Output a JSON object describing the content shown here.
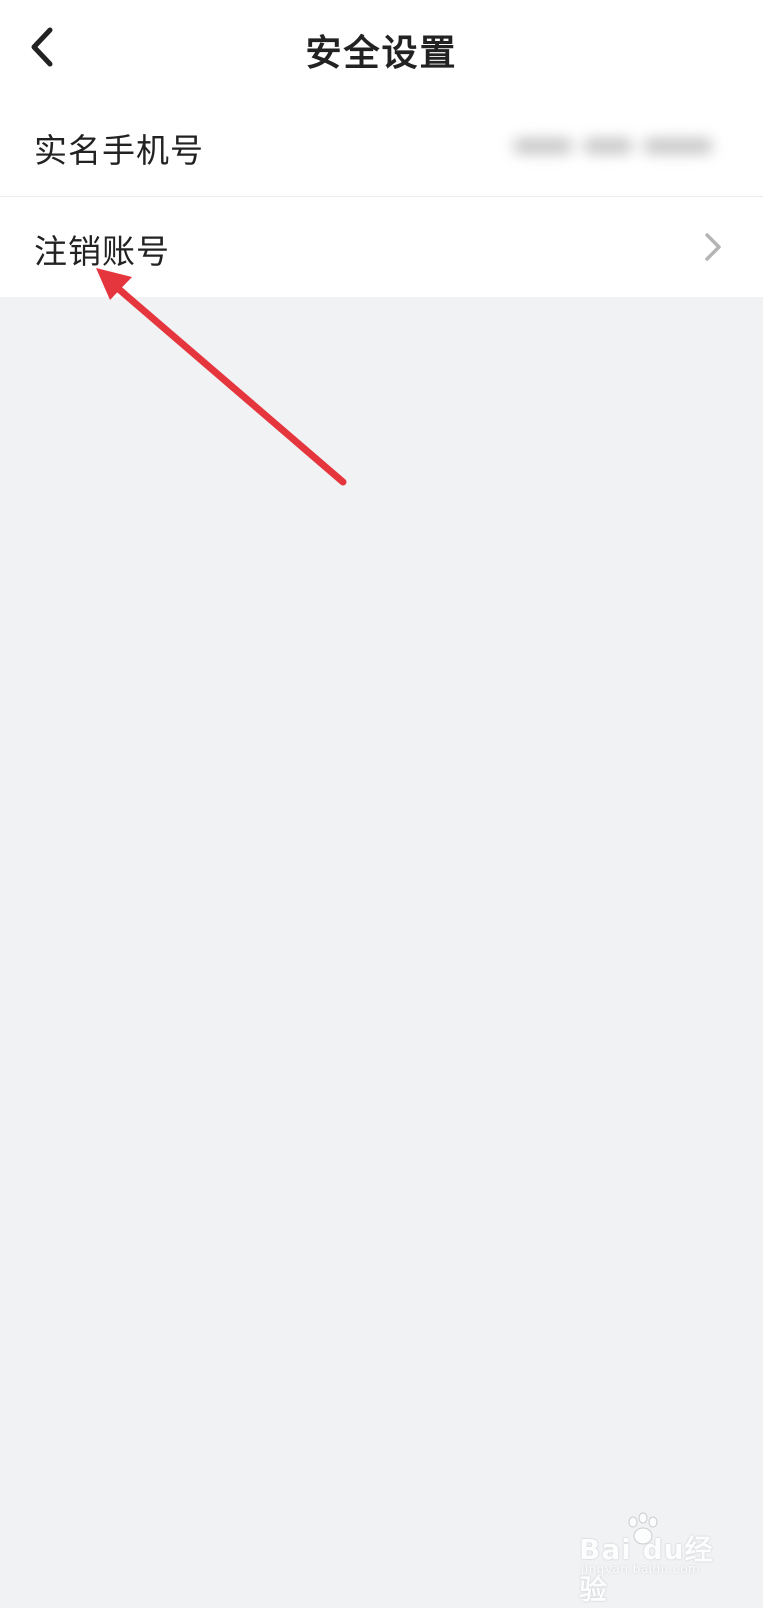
{
  "header": {
    "title": "安全设置",
    "back_icon": "chevron-left-icon"
  },
  "settings": {
    "items": [
      {
        "label": "实名手机号",
        "value_blurred": true
      },
      {
        "label": "注销账号",
        "icon": "chevron-right-icon"
      }
    ]
  },
  "annotation": {
    "arrow_color": "#e5363e"
  },
  "watermark": {
    "logo": "Bai du经验",
    "sub": "jingyan.baidu.com"
  },
  "colors": {
    "page_bg": "#f1f2f4",
    "card_bg": "#ffffff",
    "text": "#222222",
    "chevron": "#b5b5b5"
  }
}
